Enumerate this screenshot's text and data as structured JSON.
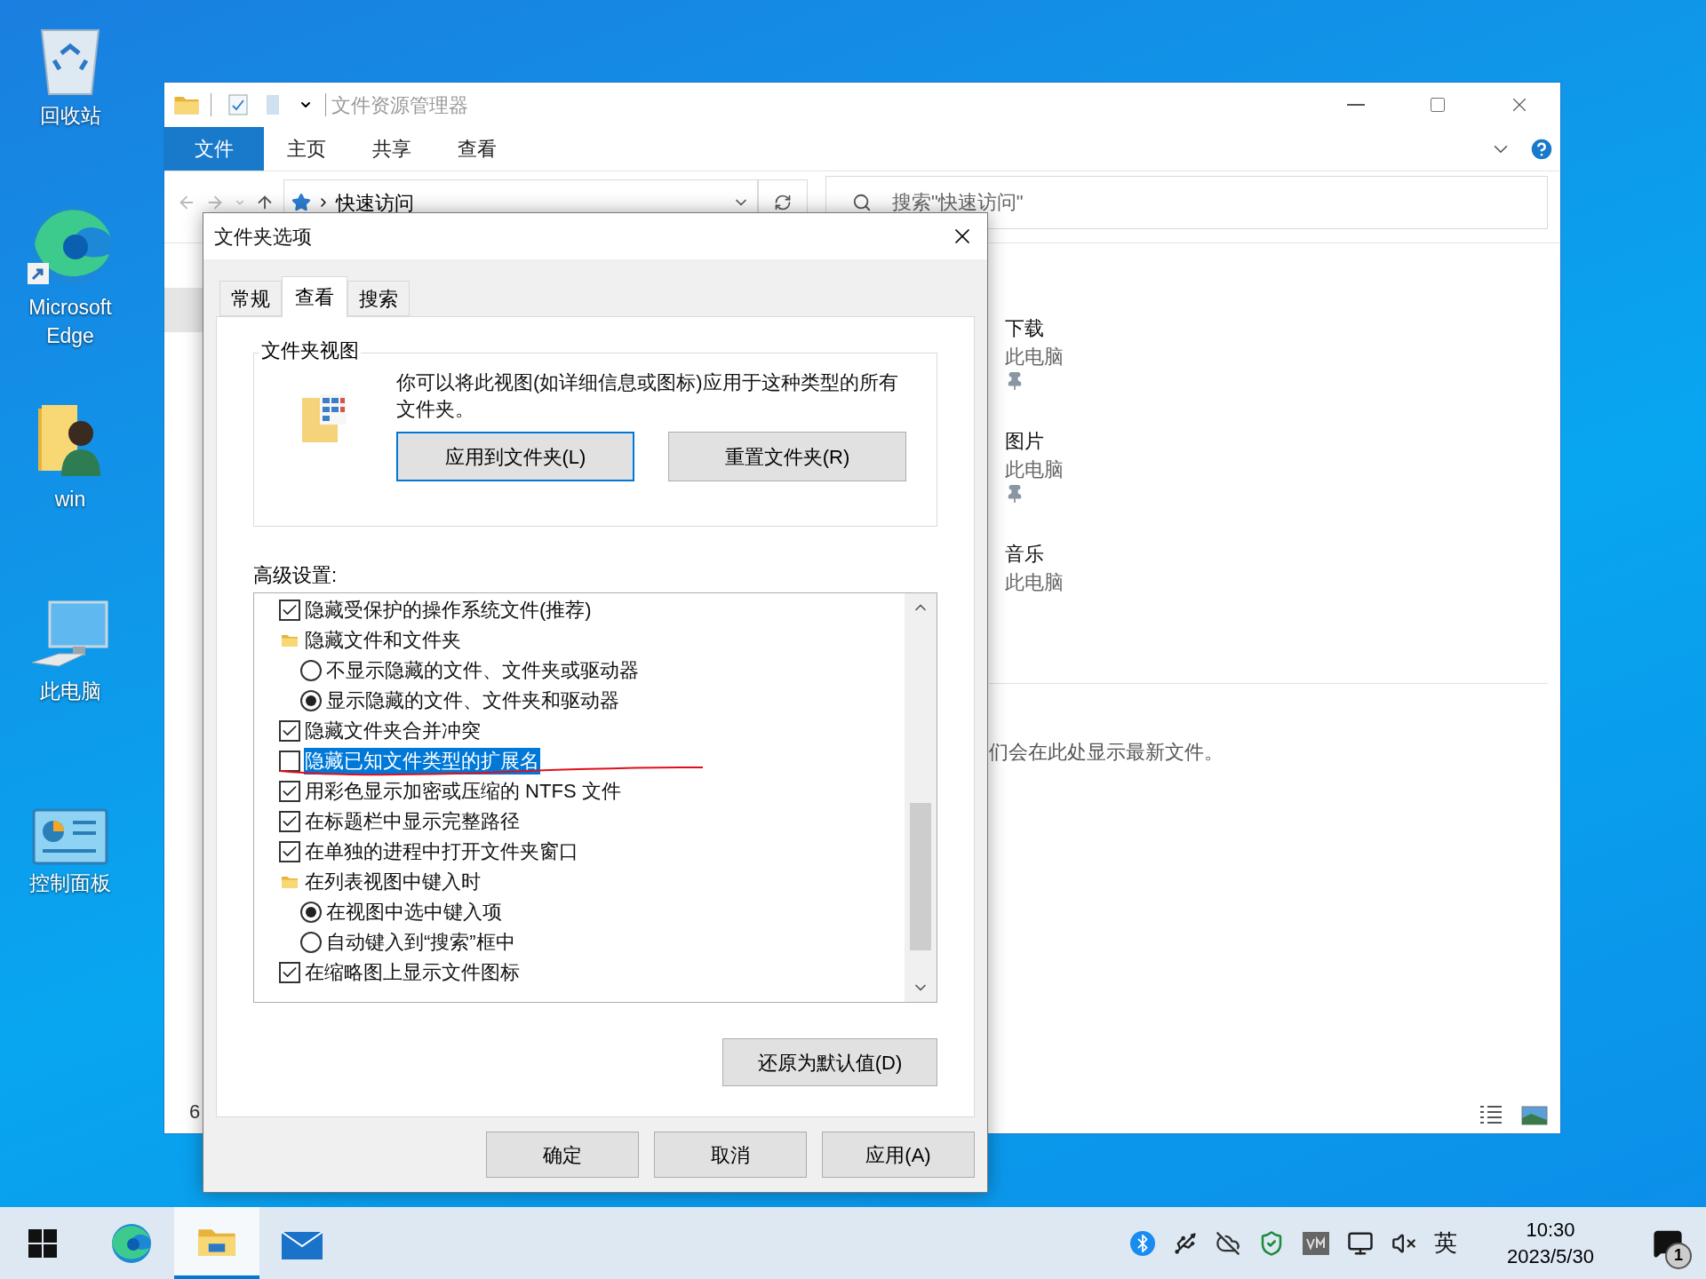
{
  "desktop_icons": [
    {
      "kind": "recycle",
      "label": "回收站"
    },
    {
      "kind": "edge",
      "label": "Microsoft Edge"
    },
    {
      "kind": "user",
      "label": "win"
    },
    {
      "kind": "computer",
      "label": "此电脑"
    },
    {
      "kind": "control",
      "label": "控制面板"
    }
  ],
  "explorer": {
    "title": "文件资源管理器",
    "ribbon_tabs": [
      {
        "label": "文件",
        "selected": true
      },
      {
        "label": "主页",
        "selected": false
      },
      {
        "label": "共享",
        "selected": false
      },
      {
        "label": "查看",
        "selected": false
      }
    ],
    "address": "快速访问",
    "search": {
      "placeholder": "搜索\"快速访问\""
    },
    "items": [
      {
        "name": "下载",
        "location": "此电脑",
        "pinned": true
      },
      {
        "name": "图片",
        "location": "此电脑",
        "pinned": true
      },
      {
        "name": "音乐",
        "location": "此电脑",
        "pinned": false
      }
    ],
    "recent_message": "们会在此处显示最新文件。",
    "status": "6"
  },
  "dialog": {
    "title": "文件夹选项",
    "tabs": [
      {
        "label": "常规",
        "selected": false
      },
      {
        "label": "查看",
        "selected": true
      },
      {
        "label": "搜索",
        "selected": false
      }
    ],
    "folder_views": {
      "heading": "文件夹视图",
      "description": "你可以将此视图(如详细信息或图标)应用于这种类型的所有文件夹。",
      "buttons": [
        {
          "label": "应用到文件夹(L)",
          "focused": true
        },
        {
          "label": "重置文件夹(R)",
          "focused": false
        }
      ]
    },
    "advanced_label": "高级设置:",
    "settings": [
      {
        "kind": "checkbox",
        "label": "隐藏受保护的操作系统文件(推荐)",
        "checked": true,
        "highlighted": false
      },
      {
        "kind": "folder",
        "label": "隐藏文件和文件夹",
        "highlighted": false
      },
      {
        "kind": "radio",
        "label": "不显示隐藏的文件、文件夹或驱动器",
        "selected": false,
        "highlighted": false
      },
      {
        "kind": "radio",
        "label": "显示隐藏的文件、文件夹和驱动器",
        "selected": true,
        "highlighted": false
      },
      {
        "kind": "checkbox",
        "label": "隐藏文件夹合并冲突",
        "checked": true,
        "highlighted": false
      },
      {
        "kind": "checkbox",
        "label": "隐藏已知文件类型的扩展名",
        "checked": false,
        "highlighted": true
      },
      {
        "kind": "checkbox",
        "label": "用彩色显示加密或压缩的 NTFS 文件",
        "checked": true,
        "highlighted": false
      },
      {
        "kind": "checkbox",
        "label": "在标题栏中显示完整路径",
        "checked": true,
        "highlighted": false
      },
      {
        "kind": "checkbox",
        "label": "在单独的进程中打开文件夹窗口",
        "checked": true,
        "highlighted": false
      },
      {
        "kind": "folder",
        "label": "在列表视图中键入时",
        "highlighted": false
      },
      {
        "kind": "radio",
        "label": "在视图中选中键入项",
        "selected": true,
        "highlighted": false
      },
      {
        "kind": "radio",
        "label": "自动键入到“搜索”框中",
        "selected": false,
        "highlighted": false
      },
      {
        "kind": "checkbox",
        "label": "在缩略图上显示文件图标",
        "checked": true,
        "highlighted": false
      }
    ],
    "restore_button": "还原为默认值(D)",
    "buttons": [
      "确定",
      "取消",
      "应用(A)"
    ]
  },
  "taskbar": {
    "apps": [
      {
        "kind": "edge",
        "selected": false
      },
      {
        "kind": "explorer",
        "selected": true
      },
      {
        "kind": "mail",
        "selected": false
      }
    ],
    "ime": "英",
    "time": "10:30",
    "date": "2023/5/30",
    "notifications": "1"
  }
}
